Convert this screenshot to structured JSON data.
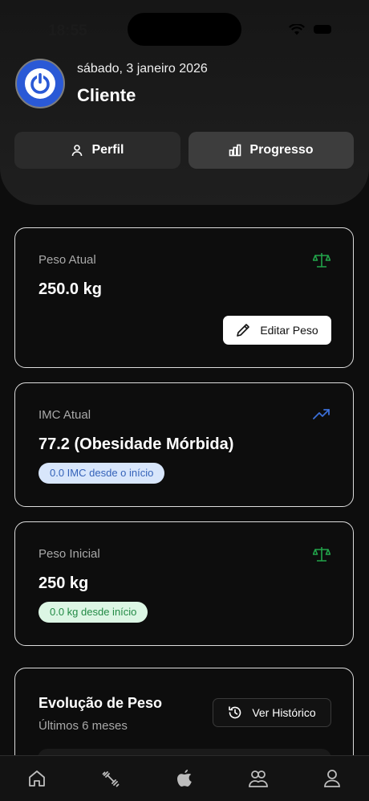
{
  "status_bar": {
    "time": "18:55"
  },
  "header": {
    "date": "sábado, 3 janeiro 2026",
    "username": "Cliente",
    "avatar_icon": "power-icon",
    "tabs": [
      {
        "label": "Perfil",
        "icon": "user-icon"
      },
      {
        "label": "Progresso",
        "icon": "bar-chart-icon"
      }
    ]
  },
  "cards": {
    "peso_atual": {
      "label": "Peso Atual",
      "value": "250.0 kg",
      "icon": "scale-icon",
      "edit_label": "Editar Peso"
    },
    "imc_atual": {
      "label": "IMC Atual",
      "value": "77.2 (Obesidade Mórbida)",
      "icon": "trending-up-icon",
      "badge": "0.0 IMC desde o início"
    },
    "peso_inicial": {
      "label": "Peso Inicial",
      "value": "250 kg",
      "icon": "scale-icon",
      "badge": "0.0 kg desde início"
    },
    "evolucao": {
      "title": "Evolução de Peso",
      "subtitle": "Últimos 6 meses",
      "history_label": "Ver Histórico"
    }
  },
  "bottom_nav": [
    "home-icon",
    "dumbbell-icon",
    "apple-icon",
    "users-icon",
    "profile-icon"
  ],
  "colors": {
    "accent_blue": "#2a59d6",
    "success_green": "#22a34a",
    "trend_blue": "#3b6fd8"
  }
}
